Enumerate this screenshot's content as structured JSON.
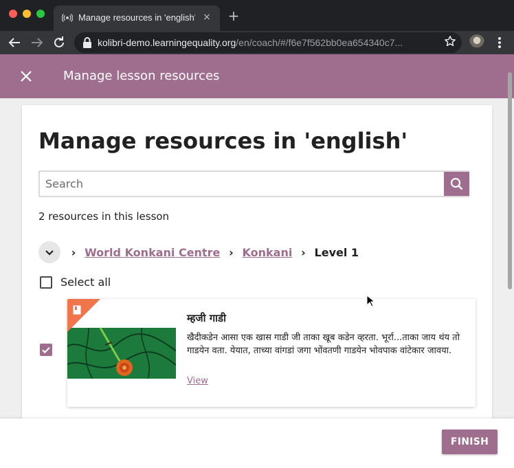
{
  "browser": {
    "tab_title": "Manage resources in 'english' - ",
    "tab_close": "×",
    "new_tab": "+",
    "url_host": "kolibri-demo.learningequality.org",
    "url_path": "/en/coach/#/f6e7f562bb0ea654340c7...",
    "icons": [
      "back-arrow-icon",
      "forward-arrow-icon",
      "reload-icon",
      "lock-icon",
      "star-icon",
      "profile-avatar",
      "menu-dots-icon",
      "audio-playing-icon"
    ]
  },
  "appbar": {
    "title": "Manage lesson resources",
    "color": "#9f6d8e"
  },
  "main": {
    "heading": "Manage resources in 'english'",
    "search_placeholder": "Search",
    "resource_count": "2 resources in this lesson",
    "breadcrumbs": {
      "items": [
        {
          "label": "World Konkani Centre",
          "link": true
        },
        {
          "label": "Konkani",
          "link": true
        },
        {
          "label": "Level 1",
          "link": false
        }
      ],
      "separator": "›"
    },
    "select_all_label": "Select all",
    "resources": [
      {
        "title": "म्हजी गाडी",
        "description": "खैदीकडेन आसा एक खास गाडी जी ताका खूब कडेन व्हरता. भूर्रा...ताका जाय थंय तो गाडयेन वता. येयात, ताच्या वांगडां जगा भोंवतणी गाडयेन भोवपाक वांटेकार जावया.",
        "view_label": "View",
        "checked": true,
        "kind_icon": "document-icon"
      }
    ]
  },
  "footer": {
    "finish_label": "FINISH"
  },
  "colors": {
    "accent": "#9f6d8e",
    "corner_badge": "#f0754b"
  }
}
